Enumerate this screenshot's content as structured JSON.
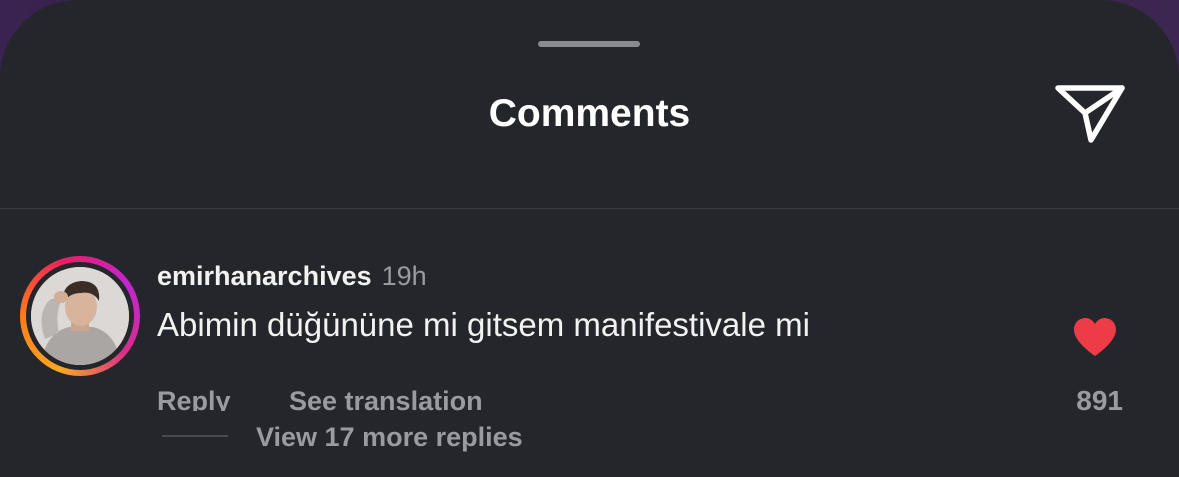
{
  "sheet": {
    "title": "Comments",
    "share_icon": "paper-plane-icon"
  },
  "comment": {
    "username": "emirhanarchives",
    "time": "19h",
    "text": "Abimin düğününe mi gitsem manifestivale mi",
    "reply_label": "Reply",
    "translate_label": "See translation",
    "like_count": "891",
    "liked": true,
    "like_icon": "heart-filled-icon",
    "view_replies_label": "View 17 more replies"
  },
  "colors": {
    "sheet_background": "#25262b",
    "primary_text": "#f2f2f2",
    "secondary_text": "#9a9ba0",
    "like_red": "#ed3b47",
    "story_ring_start": "#f9a825",
    "story_ring_end": "#c026d3"
  }
}
